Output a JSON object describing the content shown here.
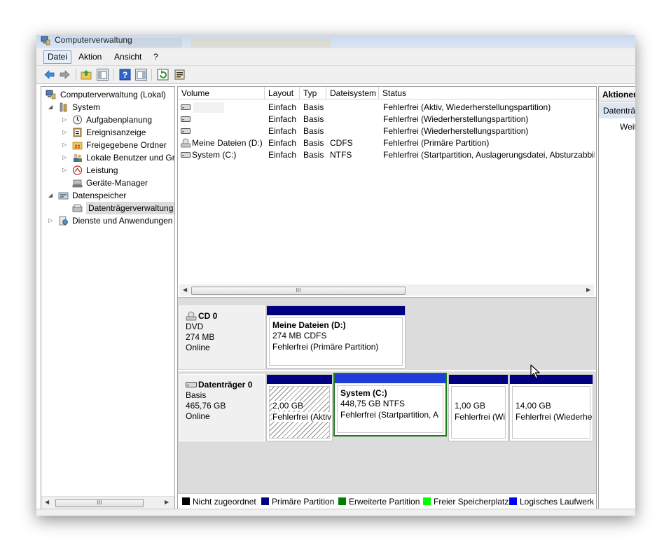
{
  "window": {
    "title": "Computerverwaltung"
  },
  "menu": [
    "Datei",
    "Aktion",
    "Ansicht",
    "?"
  ],
  "toolbar_icons": [
    "back-icon",
    "forward-icon",
    "up-folder-icon",
    "show-hide-console-tree-icon",
    "help-icon",
    "show-hide-action-pane-icon",
    "refresh-icon",
    "properties-icon"
  ],
  "tree": {
    "root": "Computerverwaltung (Lokal)",
    "system": "System",
    "aufgaben": "Aufgabenplanung",
    "ereignis": "Ereignisanzeige",
    "freigaben": "Freigegebene Ordner",
    "lokale": "Lokale Benutzer und Gruppen",
    "leistung": "Leistung",
    "geraete": "Geräte-Manager",
    "datenspeicher": "Datenspeicher",
    "datentraeger": "Datenträgerverwaltung",
    "dienste": "Dienste und Anwendungen",
    "scroll_thumb": "III"
  },
  "volumes": {
    "headers": {
      "volume": "Volume",
      "layout": "Layout",
      "typ": "Typ",
      "fs": "Dateisystem",
      "status": "Status"
    },
    "rows": [
      {
        "volume": "",
        "layout": "Einfach",
        "typ": "Basis",
        "fs": "",
        "status": "Fehlerfrei (Aktiv, Wiederherstellungspartition)"
      },
      {
        "volume": "",
        "layout": "Einfach",
        "typ": "Basis",
        "fs": "",
        "status": "Fehlerfrei (Wiederherstellungspartition)"
      },
      {
        "volume": "",
        "layout": "Einfach",
        "typ": "Basis",
        "fs": "",
        "status": "Fehlerfrei (Wiederherstellungspartition)"
      },
      {
        "volume": "Meine Dateien (D:)",
        "layout": "Einfach",
        "typ": "Basis",
        "fs": "CDFS",
        "status": "Fehlerfrei (Primäre Partition)"
      },
      {
        "volume": "System (C:)",
        "layout": "Einfach",
        "typ": "Basis",
        "fs": "NTFS",
        "status": "Fehlerfrei (Startpartition, Auslagerungsdatei, Absturzabbild)"
      }
    ],
    "scroll_thumb": "III"
  },
  "disks": {
    "cd0": {
      "name": "CD 0",
      "type": "DVD",
      "size": "274 MB",
      "state": "Online",
      "partition": {
        "title": "Meine Dateien  (D:)",
        "line2": "274 MB CDFS",
        "line3": "Fehlerfrei (Primäre Partition)"
      }
    },
    "disk0": {
      "name": "Datenträger 0",
      "type": "Basis",
      "size": "465,76 GB",
      "state": "Online",
      "partitions": [
        {
          "title": "",
          "line2": "2,00 GB",
          "line3": "Fehlerfrei (Aktiv"
        },
        {
          "title": "System  (C:)",
          "line2": "448,75 GB NTFS",
          "line3": "Fehlerfrei (Startpartition, A"
        },
        {
          "title": "",
          "line2": "1,00 GB",
          "line3": "Fehlerfrei (Wi"
        },
        {
          "title": "",
          "line2": "14,00 GB",
          "line3": "Fehlerfrei (Wiederhe"
        }
      ]
    }
  },
  "legend": [
    {
      "label": "Nicht zugeordnet",
      "color": "#000000"
    },
    {
      "label": "Primäre Partition",
      "color": "#000080"
    },
    {
      "label": "Erweiterte Partition",
      "color": "#008000"
    },
    {
      "label": "Freier Speicherplatz",
      "color": "#00ff00"
    },
    {
      "label": "Logisches Laufwerk",
      "color": "#0000ff"
    }
  ],
  "actions": {
    "header": "Aktionen",
    "sub": "Datenträgerverwaltung",
    "item": "Weitere Aktionen"
  },
  "colors": {
    "primary_bar": "#000080",
    "selection_border": "#1a7a1a",
    "system_bar": "#1e3cd8"
  }
}
